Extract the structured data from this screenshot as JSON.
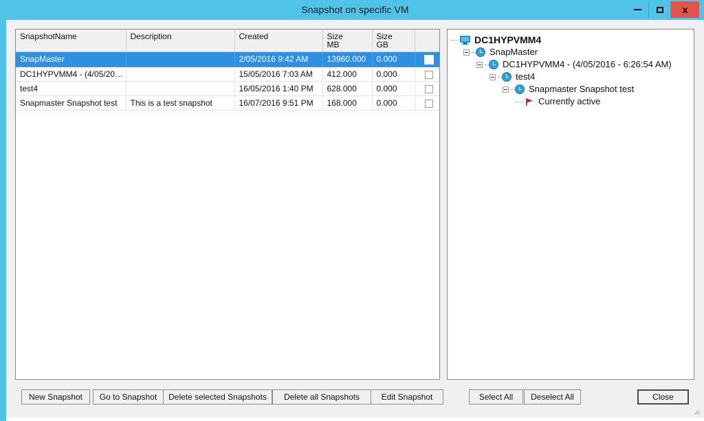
{
  "window": {
    "title": "Snapshot on specific VM",
    "minimize_label": "–",
    "maximize_label": "□",
    "close_label": "x"
  },
  "grid": {
    "columns": [
      {
        "label": "SnapshotName",
        "label2": ""
      },
      {
        "label": "Description",
        "label2": ""
      },
      {
        "label": "Created",
        "label2": ""
      },
      {
        "label": "Size",
        "label2": "MB"
      },
      {
        "label": "Size",
        "label2": "GB"
      },
      {
        "label": "",
        "label2": ""
      }
    ],
    "rows": [
      {
        "name": "SnapMaster",
        "description": "",
        "created": "2/05/2016 9:42 AM",
        "size_mb": "13960.000",
        "size_gb": "0.000",
        "checked": false,
        "selected": true
      },
      {
        "name": "DC1HYPVMM4 - (4/05/2016 ...",
        "description": "",
        "created": "15/05/2016 7:03 AM",
        "size_mb": "412.000",
        "size_gb": "0.000",
        "checked": false,
        "selected": false
      },
      {
        "name": "test4",
        "description": "",
        "created": "16/05/2016 1:40 PM",
        "size_mb": "628.000",
        "size_gb": "0.000",
        "checked": false,
        "selected": false
      },
      {
        "name": "Snapmaster Snapshot test",
        "description": "This is a test snapshot",
        "created": "16/07/2016 9:51 PM",
        "size_mb": "168.000",
        "size_gb": "0.000",
        "checked": false,
        "selected": false
      }
    ]
  },
  "tree": {
    "nodes": [
      {
        "label": "DC1HYPVMM4",
        "icon": "monitor-icon",
        "depth": 0,
        "expander": false,
        "root": true
      },
      {
        "label": "SnapMaster",
        "icon": "clock-icon",
        "depth": 1,
        "expander": true,
        "root": false
      },
      {
        "label": "DC1HYPVMM4 - (4/05/2016 - 6:26:54 AM)",
        "icon": "clock-icon",
        "depth": 2,
        "expander": true,
        "root": false
      },
      {
        "label": "test4",
        "icon": "clock-icon",
        "depth": 3,
        "expander": true,
        "root": false
      },
      {
        "label": "Snapmaster Snapshot test",
        "icon": "clock-icon",
        "depth": 4,
        "expander": true,
        "root": false
      },
      {
        "label": "Currently active",
        "icon": "flag-icon",
        "depth": 5,
        "expander": false,
        "root": false
      }
    ]
  },
  "buttons": {
    "new_snapshot": "New Snapshot",
    "go_to_snapshot": "Go to Snapshot",
    "delete_selected": "Delete selected Snapshots",
    "delete_all": "Delete all Snapshots",
    "edit_snapshot": "Edit Snapshot",
    "select_all": "Select All",
    "deselect_all": "Deselect All",
    "close": "Close"
  },
  "colors": {
    "titlebar": "#4fc3e8",
    "close_button": "#e0544a",
    "row_selected": "#2f8fe0",
    "tree_icon": "#2f9fd8",
    "flag": "#e01b24"
  }
}
